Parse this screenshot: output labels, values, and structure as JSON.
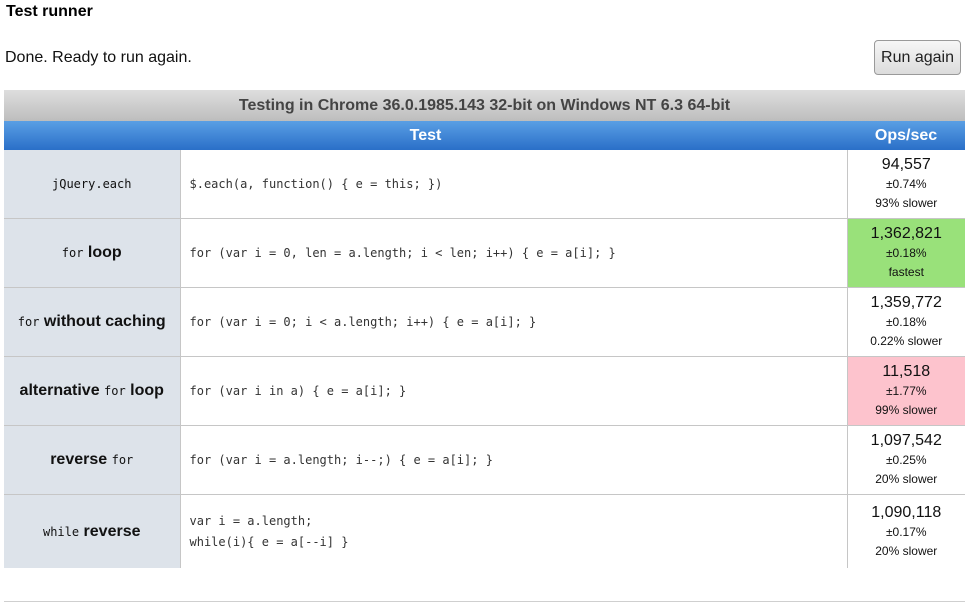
{
  "title": "Test runner",
  "status": "Done. Ready to run again.",
  "run_button": "Run again",
  "caption": "Testing in Chrome 36.0.1985.143 32-bit on Windows NT 6.3 64-bit",
  "headers": {
    "test": "Test",
    "ops": "Ops/sec"
  },
  "tests": [
    {
      "name_code": "jQuery.each",
      "name_text": "",
      "code": "$.each(a, function() { e = this; })",
      "hz": "94,557",
      "rme": "±0.74%",
      "relative": "93% slower"
    },
    {
      "name_code": "for",
      "name_text": " loop",
      "code": "for (var i = 0, len = a.length; i < len; i++) { e = a[i]; }",
      "hz": "1,362,821",
      "rme": "±0.18%",
      "relative": "fastest"
    },
    {
      "name_code": "for",
      "name_text": " without caching",
      "code": "for (var i = 0; i < a.length; i++) { e = a[i]; }",
      "hz": "1,359,772",
      "rme": "±0.18%",
      "relative": "0.22% slower"
    },
    {
      "name_pre": "alternative ",
      "name_code": "for",
      "name_text": " loop",
      "code": "for (var i in a) { e = a[i]; }",
      "hz": "11,518",
      "rme": "±1.77%",
      "relative": "99% slower"
    },
    {
      "name_pre": "reverse ",
      "name_code": "for",
      "name_text": "",
      "code": "for (var i = a.length; i--;) { e = a[i]; }",
      "hz": "1,097,542",
      "rme": "±0.25%",
      "relative": "20% slower"
    },
    {
      "name_code": "while",
      "name_text": " reverse",
      "code_line1": "var i = a.length;",
      "code_line2": "while(i){ e = a[--i] }",
      "hz": "1,090,118",
      "rme": "±0.17%",
      "relative": "20% slower"
    }
  ],
  "colors": {
    "fastest": "#99e17a",
    "slowest": "#fdc3cd",
    "header": "#3a7fd4"
  }
}
